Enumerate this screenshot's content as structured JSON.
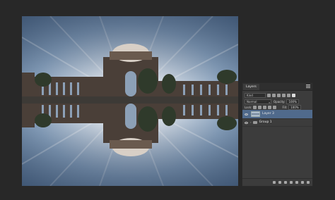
{
  "layers_panel": {
    "tab_label": "Layers",
    "kind_filter": "Kind",
    "blend_mode": "Normal",
    "opacity_label": "Opacity:",
    "opacity_value": "100%",
    "lock_label": "Lock:",
    "fill_label": "Fill:",
    "fill_value": "100%",
    "layers": [
      {
        "name": "Layer 3",
        "selected": true,
        "type": "pixel"
      },
      {
        "name": "Group 1",
        "selected": false,
        "type": "group"
      }
    ],
    "footer_icons": [
      "link-icon",
      "fx-icon",
      "mask-icon",
      "adjustment-icon",
      "folder-icon",
      "new-layer-icon",
      "trash-icon"
    ]
  },
  "colors": {
    "workspace_bg": "#282828",
    "panel_bg": "#3c3c3c",
    "selection": "#506a8c"
  }
}
